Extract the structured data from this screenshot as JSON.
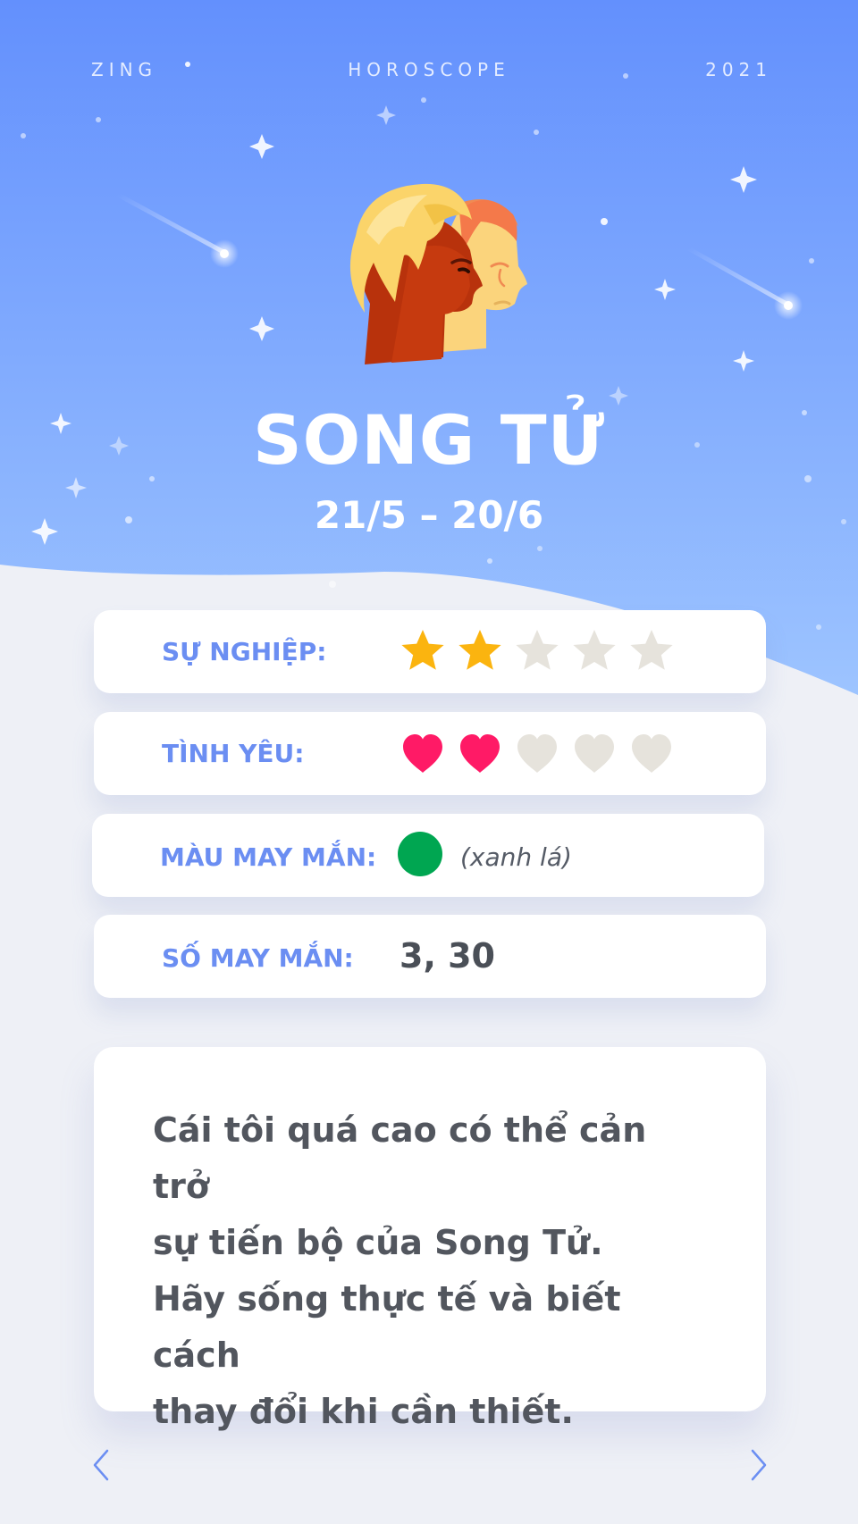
{
  "header": {
    "left": "ZING",
    "center": "HOROSCOPE",
    "right": "2021"
  },
  "sign": {
    "name": "SONG TỬ",
    "dates": "21/5 – 20/6",
    "icon": "twins-heads-icon"
  },
  "career": {
    "label": "SỰ NGHIỆP:",
    "rating": 2,
    "max": 5,
    "icon": "star-icon",
    "filled_color": "#fbb40f",
    "empty_color": "#e6e3dc"
  },
  "love": {
    "label": "TÌNH YÊU:",
    "rating": 2,
    "max": 5,
    "icon": "heart-icon",
    "filled_color": "#ff1a66",
    "empty_color": "#e6e3dc"
  },
  "lucky_color": {
    "label": "MÀU MAY MẮN:",
    "value": "(xanh lá)",
    "color": "#00a651"
  },
  "lucky_number": {
    "label": "SỐ MAY MẮN:",
    "value": "3, 30"
  },
  "description": "Cái tôi quá cao có thể cản trở\nsự tiến bộ của Song Tử.\nHãy sống thực tế và biết cách\nthay đổi khi cần thiết.",
  "colors": {
    "sky_top": "#6390fd",
    "sky_bottom": "#9dc4ff",
    "accent_label": "#6b8ef2"
  },
  "nav": {
    "prev_icon": "chevron-left-icon",
    "next_icon": "chevron-right-icon"
  }
}
